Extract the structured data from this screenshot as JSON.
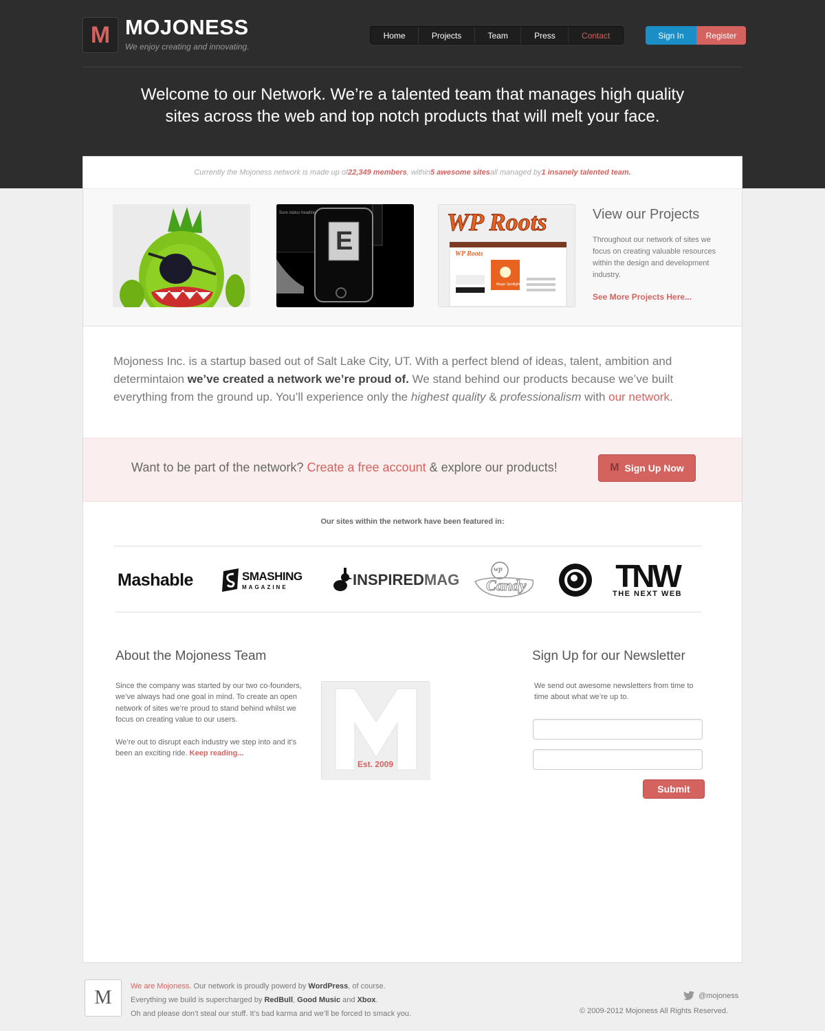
{
  "header": {
    "logo_letter": "M",
    "brand": "MOJONESS",
    "tagline": "We enjoy creating and innovating.",
    "nav": [
      "Home",
      "Projects",
      "Team",
      "Press",
      "Contact"
    ],
    "signin": "Sign In",
    "register": "Register",
    "hero_line1": "Welcome to our Network. We’re a talented team that manages high quality",
    "hero_line2": "sites across the web and top notch products that will melt your face."
  },
  "stats": {
    "prefix": "Currently the Mojoness network is made up of ",
    "members": "22,349 members",
    "mid1": ", within ",
    "sites": "5 awesome sites",
    "mid2": " all managed by ",
    "team": "1 insanely talented team."
  },
  "projects": {
    "title": "View our Projects",
    "text": "Throughout our network of sites we focus on creating valuable resources within the design and development industry.",
    "link": "See More Projects Here...",
    "thumb2_text": "Sure status heading",
    "thumb2_letter": "E",
    "thumb3_logo": "WP Roots",
    "thumb3_inner_logo": "WP Roots",
    "thumb3_caption": "Magic Spotlight"
  },
  "about": {
    "p1": "Mojoness Inc. is a startup based out of Salt Lake City, UT. With a perfect blend of ideas, talent, ambition and determintaion ",
    "bold": "we’ve created a network we’re proud of.",
    "p2": " We stand behind our products because we’ve built everything from the ground up. You’ll experience only the ",
    "i1": "highest quality",
    "amp": " & ",
    "i2": "professionalism",
    "with": " with ",
    "link": "our network",
    "end": "."
  },
  "cta": {
    "pre": "Want to be part of the network? ",
    "link": "Create a free account",
    "post": " & explore our products!",
    "button": "Sign Up Now",
    "button_icon_letter": "M"
  },
  "featured": {
    "title": "Our sites within the network have been featured in:",
    "mashable": "Mashable",
    "smashing_top": "SMASHING",
    "smashing_bottom": "MAGAZINE",
    "inspired_a": "INSPIRED",
    "inspired_b": "MAG",
    "candy": "Candy",
    "candy_wp": "wp",
    "thinkvitamin": "THINK VITAMIN",
    "tnw_big": "TNW",
    "tnw_small": "THE NEXT WEB"
  },
  "team": {
    "title": "About the Mojoness Team",
    "p1": "Since the company was started by our two co-founders, we’ve always had one goal in mind. To create an open network of sites we’re proud to stand behind whilst we focus on creating value to our users.",
    "p2": "We’re out to disrupt each industry we step into and it’s been an exciting ride. ",
    "link": "Keep reading...",
    "est": "Est. 2009"
  },
  "newsletter": {
    "title": "Sign Up for our Newsletter",
    "text": "We send out awesome newsletters from time to time about what we’re up to.",
    "input1_placeholder": "",
    "input2_placeholder": "",
    "submit": "Submit"
  },
  "footer": {
    "logo_letter": "M",
    "l1_hl": "We are Mojoness.",
    "l1_a": " Our network is proudly powerd by ",
    "l1_b": "WordPress",
    "l1_c": ", of course.",
    "l2_a": "Everything we build is supercharged by ",
    "l2_b": "RedBull",
    "l2_c": ", ",
    "l2_d": "Good Music",
    "l2_e": " and ",
    "l2_f": "Xbox",
    "l2_g": ".",
    "l3": "Oh and please don’t steal our stuff. It’s bad karma and we’ll be forced to smack you.",
    "twitter": "@mojoness",
    "copyright": "© 2009-2012 Mojoness All Rights Reserved."
  },
  "colors": {
    "accent": "#d4625f",
    "blue": "#1a8fc7",
    "dark": "#2d2d2d"
  }
}
